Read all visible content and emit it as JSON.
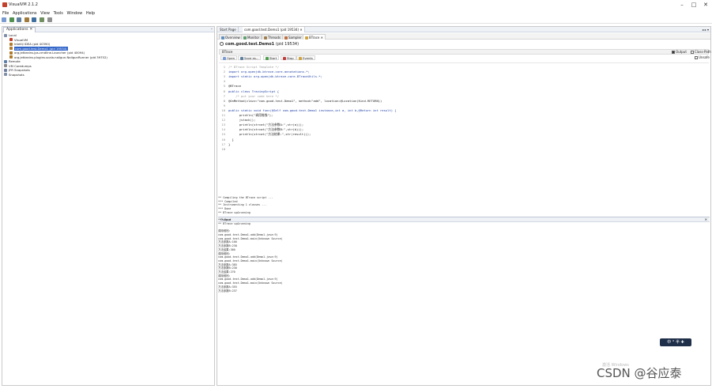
{
  "window": {
    "title": "VisualVM 2.1.2",
    "controls": [
      "–",
      "□",
      "✕"
    ]
  },
  "menu": [
    "File",
    "Applications",
    "View",
    "Tools",
    "Window",
    "Help"
  ],
  "toolbar": {
    "icons": [
      "open-icon",
      "heap-dump-icon",
      "thread-dump-icon",
      "snapshot-icon",
      "jmx-icon",
      "remote-icon",
      "refresh-icon"
    ]
  },
  "left_panel": {
    "tab": "Applications",
    "tab_close": "✕",
    "minimize": "–",
    "tree": [
      "Local",
      "VisualVM",
      "IntelliJ IDEA (pid 40390)",
      "com.good.test.Demo1 (pid 19534)",
      "org.jetbrains.jps.cmdline.Launcher (pid 40094)",
      "org.jetbrains.plugins.scala.nailgun.NailgunRunner (pid 39752)",
      "Remote",
      "VM Coredumps",
      "JFR Snapshots",
      "Snapshots"
    ]
  },
  "doc_tabs": [
    "Start Page",
    "com.good.test.Demo1 (pid 19534)"
  ],
  "doc_tab_close": "✕",
  "doc_controls": "◂ ▸ ▾",
  "sub_tabs": [
    "Overview",
    "Monitor",
    "Threads",
    "Sampler",
    "BTrace"
  ],
  "sub_tab_close": "✕",
  "process": {
    "name": "com.good.test.Demo1",
    "pid": "(pid 19534)"
  },
  "section": {
    "label": "BTrace",
    "output_label": "Output",
    "classpath_label": "Class-Path",
    "debug_label": "Unsafe"
  },
  "editor_toolbar": [
    "Open",
    "Save as...",
    "Start",
    "Stop",
    "Events"
  ],
  "code": [
    "/* BTrace Script Template */",
    "import org.openjdk.btrace.core.annotations.*;",
    "import static org.openjdk.btrace.core.BTraceUtils.*;",
    "",
    "@BTrace",
    "public class TracingScript {",
    "    /* put your code here */",
    "@OnMethod(clazz=\"com.good.test.Demo1\", method=\"add\", location=@Location(Kind.RETURN))",
    "",
    "public static void func(@Self com.good.test.Demo1 instance,int a, int b,@Return int result) {",
    "      println(\"调用堆栈\");",
    "      jstack();",
    "      println(strcat(\"方法参数A:\",str(a)));",
    "      println(strcat(\"方法参数B:\",str(b)));",
    "      println(strcat(\"方法结果:\",str(result)));",
    "  }",
    "}",
    ""
  ],
  "output": {
    "title": "Output",
    "close": "✕",
    "lines": [
      "** Compiling the BTrace script ...",
      "*** Compiled",
      "** Instrumenting 1 classes ...",
      "*** Done",
      "** BTrace up&running",
      "",
      "*** Done",
      "** BTrace up&running",
      "",
      "调用堆栈:",
      "com.good.test.Demo1.add(Demo1.java:9)",
      "com.good.test.Demo1.main(Unknown Source)",
      "方法参数A:166",
      "方法参数B:238",
      "方法结果:360",
      "调用堆栈:",
      "com.good.test.Demo1.add(Demo1.java:9)",
      "com.good.test.Demo1.main(Unknown Source)",
      "方法参数A:385",
      "方法参数B:236",
      "方法结果:270",
      "调用堆栈:",
      "com.good.test.Demo1.add(Demo1.java:9)",
      "com.good.test.Demo1.main(Unknown Source)",
      "方法参数A:355",
      "方法参数B:237"
    ]
  },
  "overlay": {
    "ime": "中 ° 半 ✚",
    "activate": "激活 Windows",
    "watermark": "CSDN @谷应泰"
  },
  "colors": {
    "selection": "#2f63c8",
    "keyword": "#1e3fa6",
    "comment": "#9a9a9a"
  }
}
